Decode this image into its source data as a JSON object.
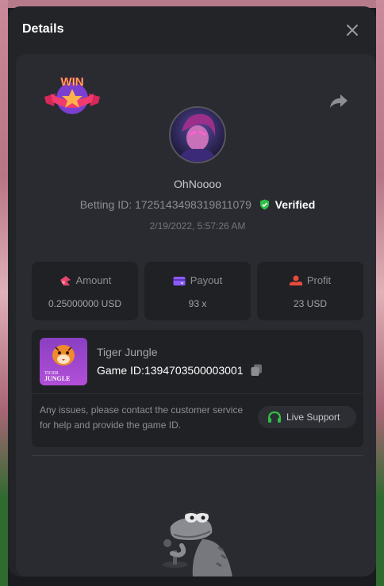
{
  "modal": {
    "title": "Details"
  },
  "bet": {
    "username": "OhNoooo",
    "betting_id_label": "Betting ID:",
    "betting_id": "1725143498319811079",
    "verified_label": "Verified",
    "timestamp": "2/19/2022, 5:57:26 AM"
  },
  "stats": {
    "amount_label": "Amount",
    "amount_value": "0.25000000 USD",
    "payout_label": "Payout",
    "payout_value": "93 x",
    "profit_label": "Profit",
    "profit_value": "23 USD"
  },
  "game": {
    "name": "Tiger Jungle",
    "id_label": "Game ID:",
    "id_value": "1394703500003001",
    "thumb_text_1": "TIGER",
    "thumb_text_2": "JUNGLE",
    "help_text": "Any issues, please contact the customer service for help and provide the game ID.",
    "support_label": "Live Support"
  },
  "badge": {
    "text": "WIN"
  },
  "colors": {
    "background": "#232428",
    "card": "#202125",
    "verified_green": "#2fbf49",
    "accent_pink": "#e8456b",
    "accent_purple": "#8b5cf6",
    "accent_red": "#e74c3c"
  },
  "icons": {
    "close": "close-icon",
    "share": "share-icon",
    "verified": "shield-check-icon",
    "amount": "money-bag-icon",
    "payout": "wallet-icon",
    "profit": "hand-coin-icon",
    "copy": "copy-icon",
    "support": "headset-icon"
  }
}
